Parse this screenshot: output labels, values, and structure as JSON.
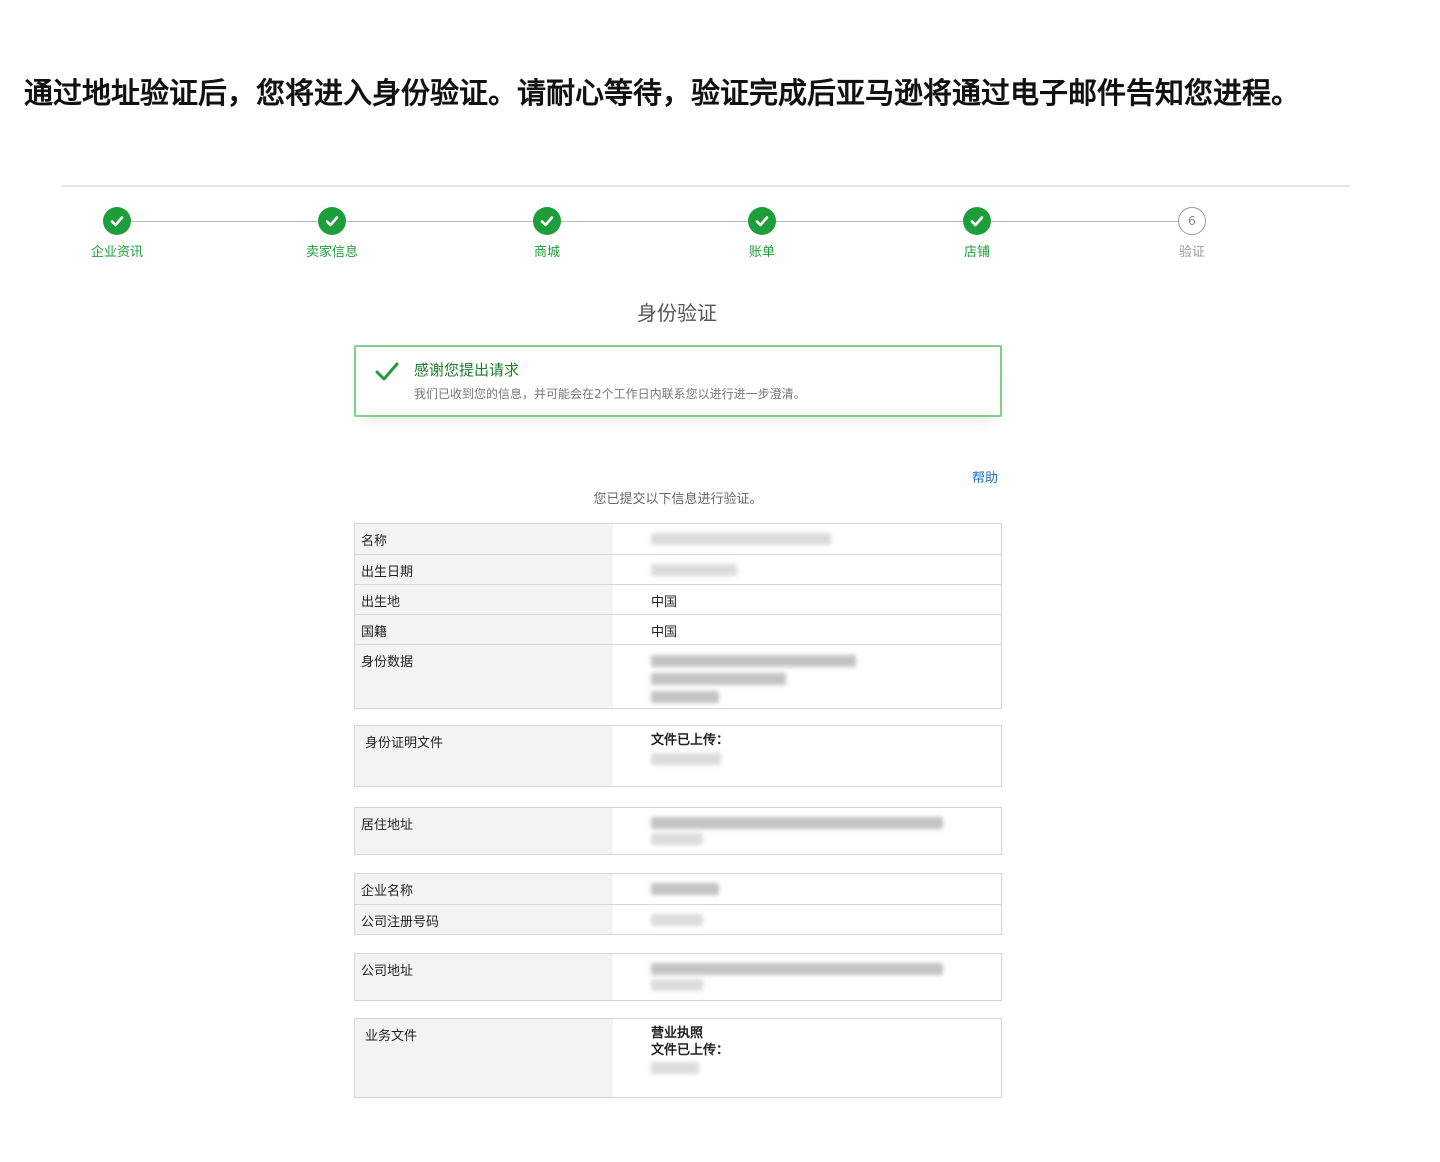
{
  "intro_text": "通过地址验证后，您将进入身份验证。请耐心等待，验证完成后亚马逊将通过电子邮件告知您进程。",
  "steps": [
    {
      "label": "企业资讯",
      "status": "done"
    },
    {
      "label": "卖家信息",
      "status": "done"
    },
    {
      "label": "商城",
      "status": "done"
    },
    {
      "label": "账单",
      "status": "done"
    },
    {
      "label": "店铺",
      "status": "done"
    },
    {
      "label": "验证",
      "status": "pending",
      "number": "6"
    }
  ],
  "page_title": "身份验证",
  "success": {
    "icon": "checkmark-icon",
    "title": "感谢您提出请求",
    "text": "我们已收到您的信息，并可能会在2个工作日内联系您以进行进一步澄清。"
  },
  "help_link": "帮助",
  "submitted_text": "您已提交以下信息进行验证。",
  "personal_table": {
    "name_label": "名称",
    "dob_label": "出生日期",
    "birthplace_label": "出生地",
    "birthplace_value": "中国",
    "nationality_label": "国籍",
    "nationality_value": "中国",
    "id_data_label": "身份数据"
  },
  "id_doc": {
    "label": "身份证明文件",
    "uploaded": "文件已上传："
  },
  "residence": {
    "label": "居住地址"
  },
  "company_table": {
    "name_label": "企业名称",
    "reg_label": "公司注册号码"
  },
  "company_address": {
    "label": "公司地址"
  },
  "business_docs": {
    "label": "业务文件",
    "doc_type": "营业执照",
    "uploaded": "文件已上传："
  },
  "colors": {
    "success_green": "#1e9e3a",
    "link_blue": "#1a6fc0",
    "box_border": "#7fd186"
  }
}
